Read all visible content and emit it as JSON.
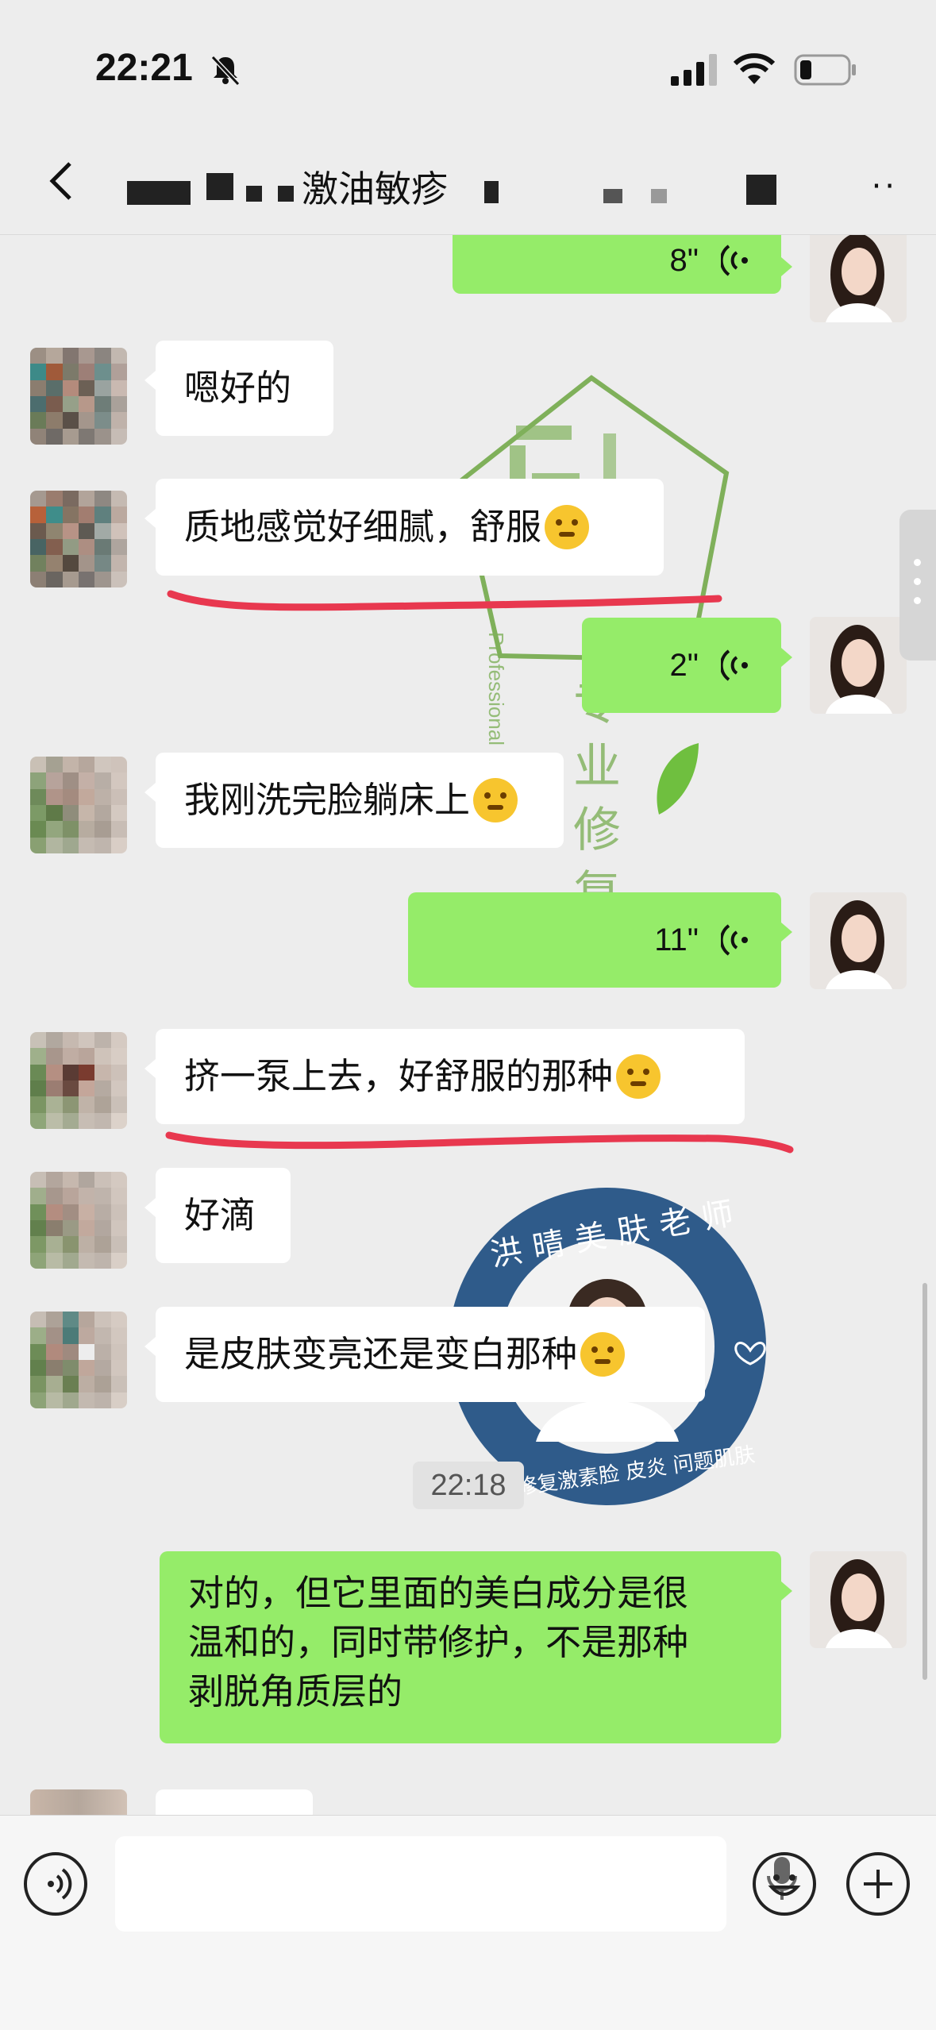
{
  "status_bar": {
    "time": "22:21"
  },
  "nav": {
    "title": "激油敏疹",
    "more": "··"
  },
  "chat": {
    "timestamp": "22:18",
    "messages": [
      {
        "side": "out",
        "type": "voice",
        "duration": "8\""
      },
      {
        "side": "in",
        "type": "text",
        "text": "嗯好的"
      },
      {
        "side": "in",
        "type": "text",
        "text": "质地感觉好细腻，舒服",
        "emoji": "thinking-face"
      },
      {
        "side": "out",
        "type": "voice",
        "duration": "2\""
      },
      {
        "side": "in",
        "type": "text",
        "text": "我刚洗完脸躺床上",
        "emoji": "thinking-face"
      },
      {
        "side": "out",
        "type": "voice",
        "duration": "11\""
      },
      {
        "side": "in",
        "type": "text",
        "text": "挤一泵上去，好舒服的那种",
        "emoji": "thinking-face"
      },
      {
        "side": "in",
        "type": "text",
        "text": "好滴"
      },
      {
        "side": "in",
        "type": "text",
        "text": "是皮肤变亮还是变白那种",
        "emoji": "thinking-face"
      },
      {
        "side": "out",
        "type": "text",
        "lines": [
          "对的，但它里面的美白成分是很",
          "温和的，同时带修护，不是那种",
          "剥脱角质层的"
        ]
      }
    ]
  },
  "watermark": {
    "arc_text": "洪晴美肤老师",
    "bottom_text": "专业修复激素脸 皮炎 问题肌肤",
    "vertical_text": "专业修复",
    "side_text": "Professional",
    "ring_color": "#2f5b8a",
    "green": "#7fb05a"
  },
  "colors": {
    "out_bubble": "#95ec69",
    "in_bubble": "#ffffff",
    "underline": "#e8384f",
    "background": "#ededed"
  },
  "input_bar": {
    "voice_icon": "voice-icon",
    "mic_icon": "mic-icon",
    "emoji_icon": "emoji-icon",
    "plus_icon": "plus-icon"
  }
}
